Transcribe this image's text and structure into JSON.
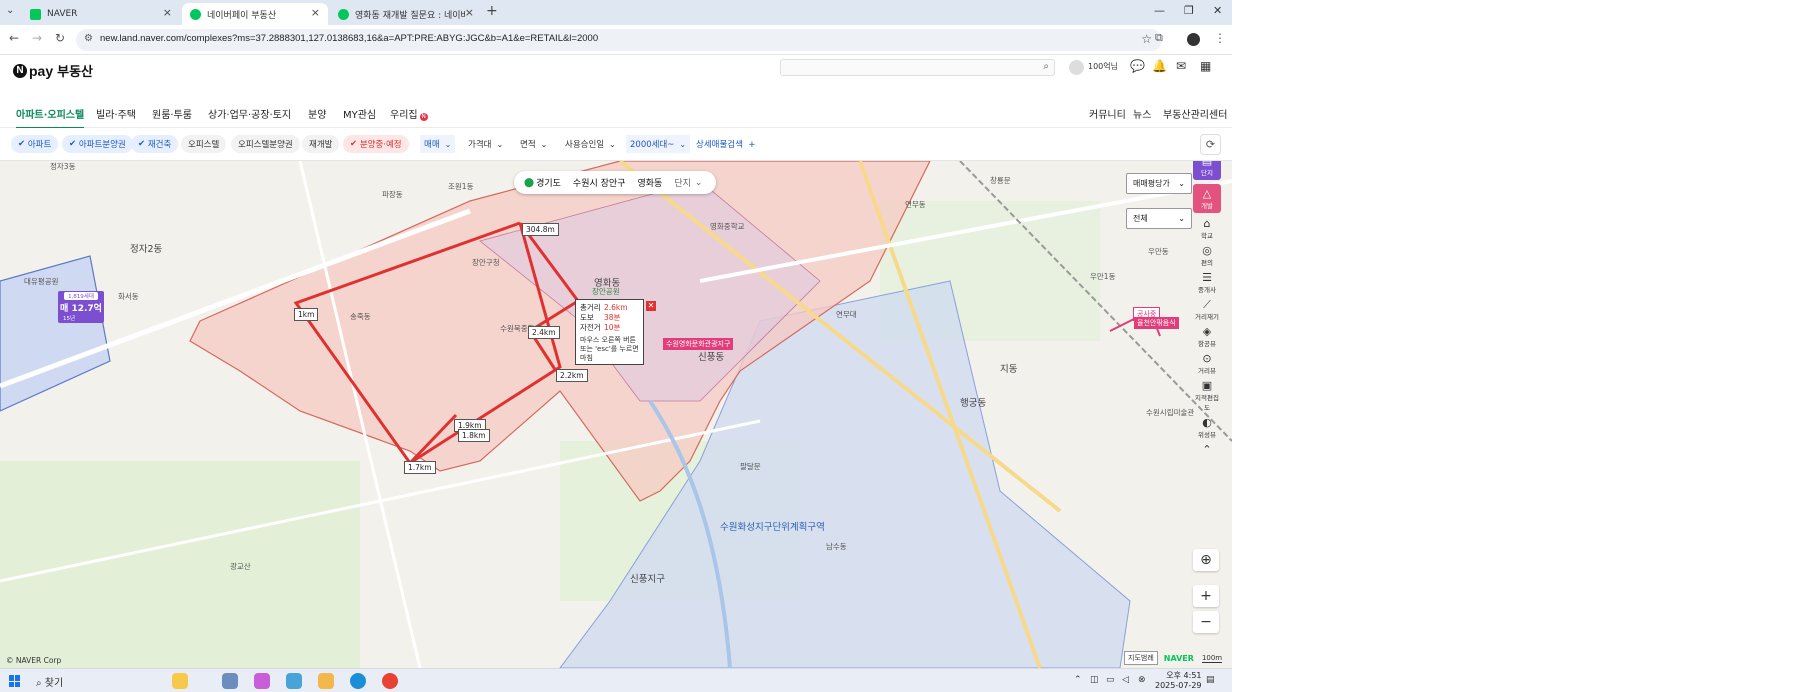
{
  "browser": {
    "tabs": [
      {
        "label": "NAVER",
        "color": "#03c75a"
      },
      {
        "label": "네이버페이 부동산",
        "color": "#03c75a"
      },
      {
        "label": "영화동 재개발 질문요 : 네이버",
        "color": "#03c75a"
      }
    ],
    "url": "new.land.naver.com/complexes?ms=37.2888301,127.0138683,16&a=APT:PRE:ABYG:JGC&b=A1&e=RETAIL&l=2000"
  },
  "header": {
    "logo_pay": "pay",
    "logo_re": "부동산",
    "user_name": "100억님"
  },
  "mainnav": {
    "items": [
      "아파트·오피스텔",
      "빌라·주택",
      "원룸·투룸",
      "상가·업무·공장·토지",
      "분양",
      "MY관심",
      "우리집"
    ],
    "badge": "N",
    "right": [
      "커뮤니티",
      "뉴스",
      "부동산관리센터"
    ]
  },
  "filters": {
    "chips": [
      "아파트",
      "아파트분양권",
      "재건축",
      "오피스텔",
      "오피스텔분양권",
      "재개발",
      "분양중·예정"
    ],
    "dropdowns": [
      "매매",
      "가격대",
      "면적",
      "사용승인일",
      "2000세대~"
    ],
    "detail_search": "상세매물검색"
  },
  "map": {
    "breadcrumb": {
      "province": "경기도",
      "city": "수원시 장안구",
      "dong": "영화동",
      "extra": "단지"
    },
    "price_badge": {
      "top": "1,819세대",
      "mid": "매 12.7억",
      "low": "15년"
    },
    "right_selects": [
      "매매평당가",
      "전체"
    ],
    "distances": [
      "304.8m",
      "1km",
      "2.4km",
      "2.2km",
      "1.9km",
      "1.8km",
      "1.7km"
    ],
    "popup": {
      "rows": [
        {
          "k": "총거리",
          "v": "2.6km"
        },
        {
          "k": "도보",
          "v": "38분"
        },
        {
          "k": "자전거",
          "v": "10분"
        }
      ],
      "note": "마우스 오른쪽 버튼 또는 'esc'를 누르면 마침"
    },
    "pink_labels": [
      "수원영화문화관광지구",
      "공사중",
      "율천안팎음식"
    ],
    "side_tools": [
      "단지",
      "개발",
      "학교",
      "편의",
      "중개사",
      "거리재기",
      "항공뷰",
      "거리뷰",
      "지적편집도",
      "위성뷰"
    ],
    "labels": [
      "정자2동",
      "영화동",
      "조원1동",
      "파장동",
      "연무동",
      "우만1동",
      "우만동",
      "정자3동",
      "수원화성지구단위계획구역",
      "남수동",
      "신풍지구",
      "대유평공원",
      "화서동",
      "송죽동",
      "장안구청",
      "수원북중학교",
      "장안공원",
      "연무대",
      "신풍동",
      "행궁동",
      "팔달문",
      "지동",
      "창룡문",
      "수원시립미술관",
      "영화중학교",
      "광교산"
    ],
    "copyright": "© NAVER Corp",
    "cadastral": "지도범례",
    "naver": "NAVER",
    "scale": "100m"
  },
  "taskbar": {
    "search": "찾기",
    "time": "오후 4:51",
    "date": "2025-07-29"
  }
}
